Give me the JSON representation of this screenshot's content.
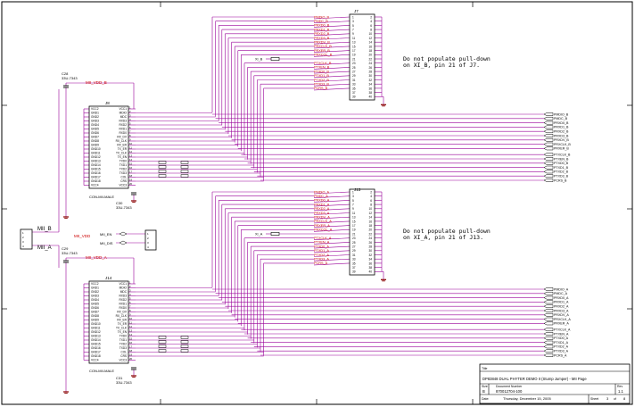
{
  "colors": {
    "wire": "#990099",
    "part": "#000000",
    "netlabel": "#cc0000",
    "ground": "#880000",
    "border": "#000000"
  },
  "notes": {
    "top": [
      "Do not populate pull-down",
      "on XI_B, pin 21 of J7."
    ],
    "bottom": [
      "Do not populate pull-down",
      "on XI_A, pin 21 of J13."
    ]
  },
  "connectors": {
    "j7": "J7",
    "j13": "J13",
    "j8": "J8",
    "j14": "J14",
    "j8_part": "CON-MII-MALE",
    "j14_part": "CON-MII-MALE"
  },
  "caps": {
    "c28": "C28",
    "c28_val": "33U-7343",
    "c30": "C30",
    "c30_val": "33U-7343",
    "c29": "C29",
    "c29_val": "33U-7343",
    "c31": "C31",
    "c31_val": "33U-7343"
  },
  "power": {
    "top": "MII_VDD_B",
    "bottom": "MII_VDD_A",
    "mid": "MII_VDD"
  },
  "ports": {
    "mii_b": "MII_B",
    "mii_a": "MII_A",
    "mii_en": "MII_EN",
    "mii_dis": "MII_DIS"
  },
  "nets_top": {
    "j7_side": [
      "PMDIO_B",
      "PMDC_B",
      "PRXD0_B",
      "PRXD1_B",
      "PRXD2_B",
      "PRXD3_B",
      "PRXDV_B",
      "PRXCLK_B",
      "PRXER_B",
      "PRXCOL_B",
      "PTXCLK_B",
      "PTXEN_B",
      "PTXD0_B",
      "PTXD1_B",
      "PTXD2_B",
      "PTXD3_B",
      "PCRS_B"
    ],
    "xi": "XI_B"
  },
  "nets_bottom": {
    "j13_side": [
      "PMDIO_A",
      "PMDC_A",
      "PRXD0_A",
      "PRXD1_A",
      "PRXD2_A",
      "PRXD3_A",
      "PRXDV_A",
      "PRXCLK_A",
      "PRXER_A",
      "PRXCOL_A",
      "PTXCLK_A",
      "PTXEN_A",
      "PTXD0_A",
      "PTXD1_A",
      "PTXD2_A",
      "PTXD3_A",
      "PCRS_A"
    ],
    "xi": "XI_A"
  },
  "ports_right_top": [
    "PMDIO_B",
    "PMDC_B",
    "PRXD0_B",
    "PRXD1_B",
    "PRXD2_B",
    "PRXD3_B",
    "PRXDV_B",
    "PRXCLK_B",
    "PRXER_B",
    "PTXCLK_B",
    "PTXEN_B",
    "PTXD0_B",
    "PTXD1_B",
    "PTXD2_B",
    "PTXD3_B",
    "PCRS_B"
  ],
  "ports_right_bottom": [
    "PMDIO_A",
    "PMDC_A",
    "PRXD0_A",
    "PRXD1_A",
    "PRXD2_A",
    "PRXD3_A",
    "PRXDV_A",
    "PRXCLK_A",
    "PRXER_A",
    "PTXCLK_A",
    "PTXEN_A",
    "PTXD0_A",
    "PTXD1_A",
    "PTXD2_A",
    "PTXD3_A",
    "PCRS_A"
  ],
  "mii_pins_left": [
    "VCC2",
    "GND1",
    "GND2",
    "GND3",
    "GND4",
    "GND5",
    "GND6",
    "GND7",
    "GND8",
    "GND9",
    "GND10",
    "GND11",
    "GND12",
    "GND13",
    "GND14",
    "GND15",
    "GND16",
    "GND17",
    "GND18",
    "VCC4"
  ],
  "mii_pins_right": [
    "VCC1",
    "MDIO",
    "MDC",
    "RXD3",
    "RXD2",
    "RXD1",
    "RXD0",
    "RX_DV",
    "RX_CLK",
    "RX_ER",
    "TX_ER",
    "TX_CLK",
    "TX_EN",
    "TXD0",
    "TXD1",
    "TXD2",
    "TXD3",
    "COL",
    "CRS",
    "VCC3"
  ],
  "title_block": {
    "title_label": "Title",
    "title": "DP83848 DUAL PHYTER DEMO II (Stump Jumper) - MII Page",
    "size_label": "Size",
    "size": "B",
    "doc_label": "Document Number",
    "doc": "870012704-100",
    "rev_label": "Rev",
    "rev": "1.1",
    "date_label": "Date:",
    "date": "Thursday, December 15, 2005",
    "sheet_label": "Sheet",
    "sheet": "3",
    "of_label": "of",
    "of": "8"
  }
}
